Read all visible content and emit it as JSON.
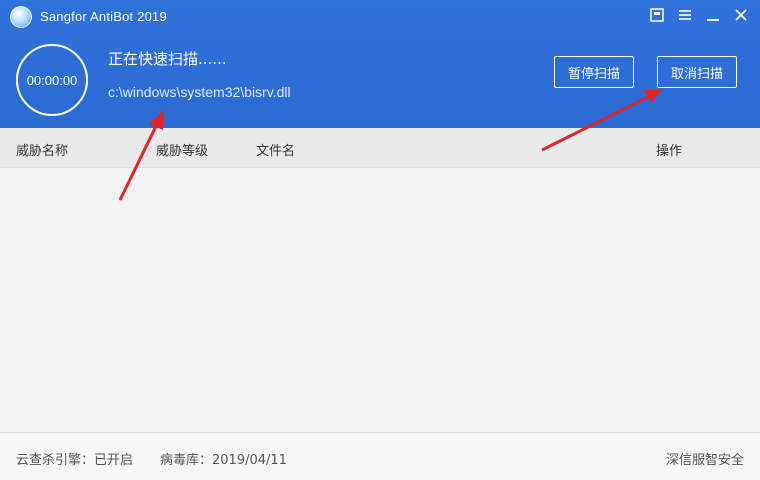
{
  "window": {
    "title": "Sangfor AntiBot 2019",
    "controls": [
      "feedback-icon",
      "settings-icon",
      "minimize-icon",
      "close-icon"
    ]
  },
  "scan": {
    "timer": "00:00:00",
    "status": "正在快速扫描......",
    "current_path": "c:\\windows\\system32\\bisrv.dll",
    "pause_label": "暂停扫描",
    "cancel_label": "取消扫描"
  },
  "table": {
    "columns": [
      "威胁名称",
      "威胁等级",
      "文件名",
      "操作"
    ],
    "rows": []
  },
  "footer": {
    "engine_status": "云查杀引擎：已开启",
    "virus_db": "病毒库：2019/04/11",
    "brand": "深信服智安全"
  },
  "colors": {
    "header_bg": "#2f72d9",
    "annotation_arrow": "#e0242a"
  }
}
